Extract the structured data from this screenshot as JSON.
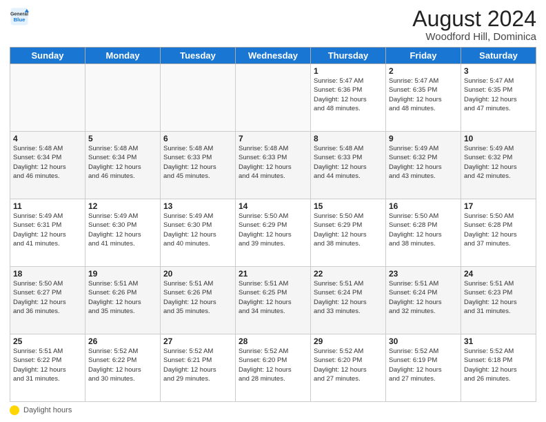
{
  "header": {
    "logo_line1": "General",
    "logo_line2": "Blue",
    "month_year": "August 2024",
    "location": "Woodford Hill, Dominica"
  },
  "days_of_week": [
    "Sunday",
    "Monday",
    "Tuesday",
    "Wednesday",
    "Thursday",
    "Friday",
    "Saturday"
  ],
  "weeks": [
    [
      {
        "day": "",
        "info": ""
      },
      {
        "day": "",
        "info": ""
      },
      {
        "day": "",
        "info": ""
      },
      {
        "day": "",
        "info": ""
      },
      {
        "day": "1",
        "info": "Sunrise: 5:47 AM\nSunset: 6:36 PM\nDaylight: 12 hours\nand 48 minutes."
      },
      {
        "day": "2",
        "info": "Sunrise: 5:47 AM\nSunset: 6:35 PM\nDaylight: 12 hours\nand 48 minutes."
      },
      {
        "day": "3",
        "info": "Sunrise: 5:47 AM\nSunset: 6:35 PM\nDaylight: 12 hours\nand 47 minutes."
      }
    ],
    [
      {
        "day": "4",
        "info": "Sunrise: 5:48 AM\nSunset: 6:34 PM\nDaylight: 12 hours\nand 46 minutes."
      },
      {
        "day": "5",
        "info": "Sunrise: 5:48 AM\nSunset: 6:34 PM\nDaylight: 12 hours\nand 46 minutes."
      },
      {
        "day": "6",
        "info": "Sunrise: 5:48 AM\nSunset: 6:33 PM\nDaylight: 12 hours\nand 45 minutes."
      },
      {
        "day": "7",
        "info": "Sunrise: 5:48 AM\nSunset: 6:33 PM\nDaylight: 12 hours\nand 44 minutes."
      },
      {
        "day": "8",
        "info": "Sunrise: 5:48 AM\nSunset: 6:33 PM\nDaylight: 12 hours\nand 44 minutes."
      },
      {
        "day": "9",
        "info": "Sunrise: 5:49 AM\nSunset: 6:32 PM\nDaylight: 12 hours\nand 43 minutes."
      },
      {
        "day": "10",
        "info": "Sunrise: 5:49 AM\nSunset: 6:32 PM\nDaylight: 12 hours\nand 42 minutes."
      }
    ],
    [
      {
        "day": "11",
        "info": "Sunrise: 5:49 AM\nSunset: 6:31 PM\nDaylight: 12 hours\nand 41 minutes."
      },
      {
        "day": "12",
        "info": "Sunrise: 5:49 AM\nSunset: 6:30 PM\nDaylight: 12 hours\nand 41 minutes."
      },
      {
        "day": "13",
        "info": "Sunrise: 5:49 AM\nSunset: 6:30 PM\nDaylight: 12 hours\nand 40 minutes."
      },
      {
        "day": "14",
        "info": "Sunrise: 5:50 AM\nSunset: 6:29 PM\nDaylight: 12 hours\nand 39 minutes."
      },
      {
        "day": "15",
        "info": "Sunrise: 5:50 AM\nSunset: 6:29 PM\nDaylight: 12 hours\nand 38 minutes."
      },
      {
        "day": "16",
        "info": "Sunrise: 5:50 AM\nSunset: 6:28 PM\nDaylight: 12 hours\nand 38 minutes."
      },
      {
        "day": "17",
        "info": "Sunrise: 5:50 AM\nSunset: 6:28 PM\nDaylight: 12 hours\nand 37 minutes."
      }
    ],
    [
      {
        "day": "18",
        "info": "Sunrise: 5:50 AM\nSunset: 6:27 PM\nDaylight: 12 hours\nand 36 minutes."
      },
      {
        "day": "19",
        "info": "Sunrise: 5:51 AM\nSunset: 6:26 PM\nDaylight: 12 hours\nand 35 minutes."
      },
      {
        "day": "20",
        "info": "Sunrise: 5:51 AM\nSunset: 6:26 PM\nDaylight: 12 hours\nand 35 minutes."
      },
      {
        "day": "21",
        "info": "Sunrise: 5:51 AM\nSunset: 6:25 PM\nDaylight: 12 hours\nand 34 minutes."
      },
      {
        "day": "22",
        "info": "Sunrise: 5:51 AM\nSunset: 6:24 PM\nDaylight: 12 hours\nand 33 minutes."
      },
      {
        "day": "23",
        "info": "Sunrise: 5:51 AM\nSunset: 6:24 PM\nDaylight: 12 hours\nand 32 minutes."
      },
      {
        "day": "24",
        "info": "Sunrise: 5:51 AM\nSunset: 6:23 PM\nDaylight: 12 hours\nand 31 minutes."
      }
    ],
    [
      {
        "day": "25",
        "info": "Sunrise: 5:51 AM\nSunset: 6:22 PM\nDaylight: 12 hours\nand 31 minutes."
      },
      {
        "day": "26",
        "info": "Sunrise: 5:52 AM\nSunset: 6:22 PM\nDaylight: 12 hours\nand 30 minutes."
      },
      {
        "day": "27",
        "info": "Sunrise: 5:52 AM\nSunset: 6:21 PM\nDaylight: 12 hours\nand 29 minutes."
      },
      {
        "day": "28",
        "info": "Sunrise: 5:52 AM\nSunset: 6:20 PM\nDaylight: 12 hours\nand 28 minutes."
      },
      {
        "day": "29",
        "info": "Sunrise: 5:52 AM\nSunset: 6:20 PM\nDaylight: 12 hours\nand 27 minutes."
      },
      {
        "day": "30",
        "info": "Sunrise: 5:52 AM\nSunset: 6:19 PM\nDaylight: 12 hours\nand 27 minutes."
      },
      {
        "day": "31",
        "info": "Sunrise: 5:52 AM\nSunset: 6:18 PM\nDaylight: 12 hours\nand 26 minutes."
      }
    ]
  ],
  "footer": {
    "daylight_label": "Daylight hours"
  }
}
